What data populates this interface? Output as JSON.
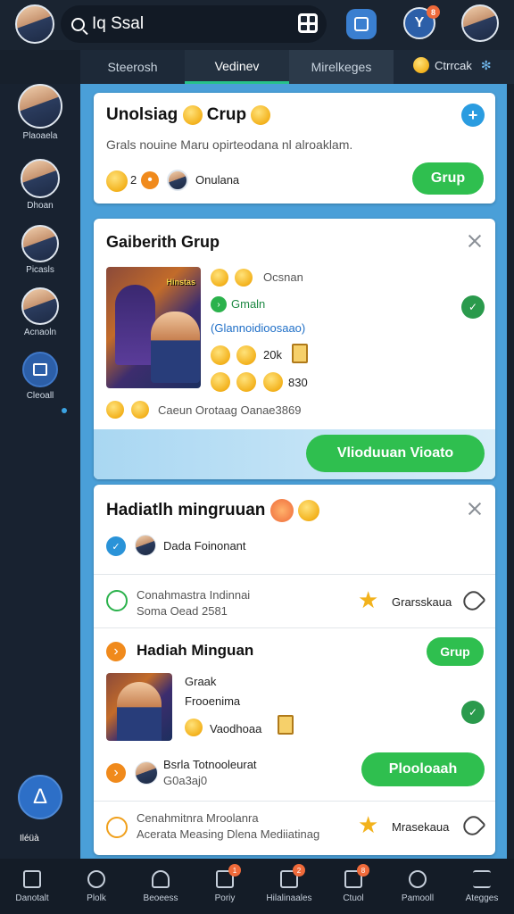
{
  "topbar": {
    "search_value": "Iq Ssal",
    "notification_count": "8"
  },
  "tabs": [
    "Steerosh",
    "Vedinev",
    "Mirelkeges"
  ],
  "tab_extra_label": "Ctrrcak",
  "sidebar": {
    "items": [
      "Plaoaela",
      "Dhoan",
      "Picasls",
      "Acnaoln",
      "Cleoall"
    ],
    "bottom_label": "Iléüà"
  },
  "card1": {
    "title": "Unolsiag",
    "title_suffix": "Crup",
    "description": "Grals nouine Maru opirteodana nl alroaklam.",
    "count": "2",
    "member_label": "Onulana",
    "button": "Grup"
  },
  "card2": {
    "title": "Gaiberith Grup",
    "line1": "Ocsnan",
    "line2": "Gmaln",
    "line3": "(Glannoidioosaao)",
    "stat1": "20k",
    "stat2": "830",
    "footer_text": "Caeun Orotaag Oanae3869",
    "button": "Vlioduuan Vioato"
  },
  "card3": {
    "title": "Hadiatlh mingruuan",
    "row1_label": "Dada Foinonant",
    "row2_line1": "Conahmastra Indinnai",
    "row2_line2": "Soma Oead 2581",
    "row2_side": "Grarsskaua",
    "section_title": "Hadiah Minguan",
    "section_button": "Grup",
    "item_line1": "Graak",
    "item_line2": "Frooenima",
    "item_line3": "Vaodhoaa",
    "poster_text": "Bsrla Totnooleurat",
    "poster_sub": "G0a3aj0",
    "poster_button": "Plooloaah",
    "row3_line1": "Cenahmitnra Mroolanra",
    "row3_line2": "Acerata Measing Dlena Mediiatinag",
    "row3_side": "Mrasekaua"
  },
  "poster_caption": "Hinstas",
  "bottom_nav": [
    {
      "label": "Danotalt",
      "badge": ""
    },
    {
      "label": "Plolk",
      "badge": ""
    },
    {
      "label": "Beoeess",
      "badge": ""
    },
    {
      "label": "Poriy",
      "badge": "1"
    },
    {
      "label": "Hilalinaales",
      "badge": "2"
    },
    {
      "label": "Ctuol",
      "badge": "8"
    },
    {
      "label": "Pamooll",
      "badge": ""
    },
    {
      "label": "Ategges",
      "badge": ""
    }
  ],
  "colors": {
    "accent_green": "#2fbf4f",
    "accent_blue": "#2a9ce0",
    "panel_blue": "#4a9fd8",
    "badge_orange": "#ef6a3a"
  }
}
